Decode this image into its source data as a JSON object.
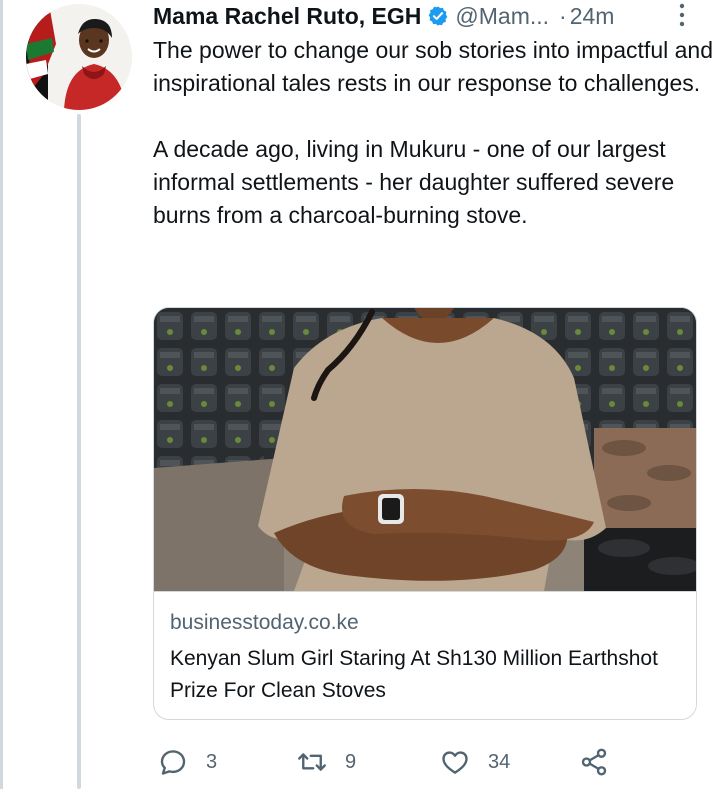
{
  "tweet": {
    "display_name": "Mama Rachel Ruto, EGH",
    "handle": "@Mam...",
    "separator": "·",
    "time": "24m",
    "verified_color": "#1d9bf0",
    "paragraphs": [
      "The power to change our sob stories into impactful and inspirational tales rests in our response to challenges.",
      "A decade ago, living in Mukuru - one of our largest informal settlements - her daughter suffered severe burns from a charcoal-burning stove."
    ],
    "card": {
      "domain": "businesstoday.co.ke",
      "title": "Kenyan Slum Girl Staring At Sh130 Million Earthshot Prize For Clean Stoves"
    },
    "actions": {
      "replies": "3",
      "retweets": "9",
      "likes": "34"
    }
  },
  "icons": [
    "verified-badge-icon",
    "more-options-icon",
    "reply-icon",
    "retweet-icon",
    "like-icon",
    "share-icon"
  ]
}
